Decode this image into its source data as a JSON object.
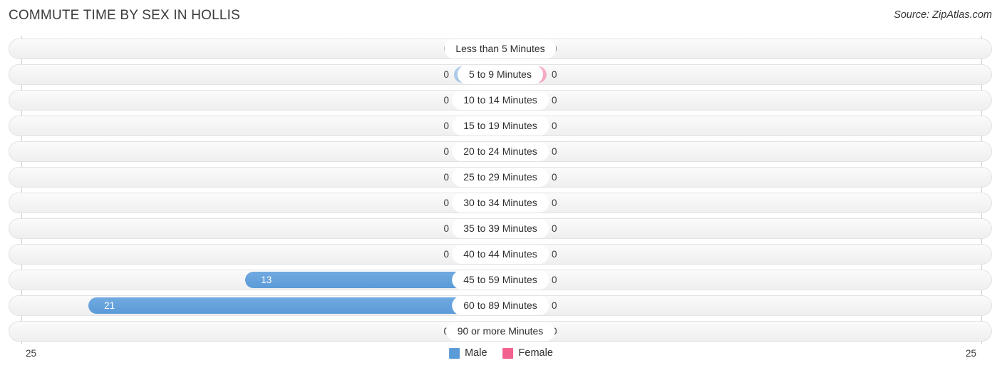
{
  "header": {
    "title": "COMMUTE TIME BY SEX IN HOLLIS",
    "source": "Source: ZipAtlas.com"
  },
  "legend": {
    "male_label": "Male",
    "female_label": "Female",
    "male_color": "#5b9bd8",
    "female_color": "#f2628f"
  },
  "axis": {
    "left_tick": "25",
    "right_tick": "25"
  },
  "chart_data": {
    "type": "bar",
    "title": "COMMUTE TIME BY SEX IN HOLLIS",
    "subtitle": "Source: ZipAtlas.com",
    "orientation": "horizontal-diverging",
    "xlabel": "",
    "ylabel": "",
    "xlim": [
      25,
      25
    ],
    "grid": false,
    "legend_position": "bottom-center",
    "categories": [
      "Less than 5 Minutes",
      "5 to 9 Minutes",
      "10 to 14 Minutes",
      "15 to 19 Minutes",
      "20 to 24 Minutes",
      "25 to 29 Minutes",
      "30 to 34 Minutes",
      "35 to 39 Minutes",
      "40 to 44 Minutes",
      "45 to 59 Minutes",
      "60 to 89 Minutes",
      "90 or more Minutes"
    ],
    "series": [
      {
        "name": "Male",
        "values": [
          0,
          0,
          0,
          0,
          0,
          0,
          0,
          0,
          0,
          13,
          21,
          0
        ]
      },
      {
        "name": "Female",
        "values": [
          0,
          0,
          0,
          0,
          0,
          0,
          0,
          0,
          0,
          0,
          0,
          0
        ]
      }
    ],
    "male_labels": [
      "0",
      "0",
      "0",
      "0",
      "0",
      "0",
      "0",
      "0",
      "0",
      "13",
      "21",
      "0"
    ],
    "female_labels": [
      "0",
      "0",
      "0",
      "0",
      "0",
      "0",
      "0",
      "0",
      "0",
      "0",
      "0",
      "0"
    ]
  }
}
